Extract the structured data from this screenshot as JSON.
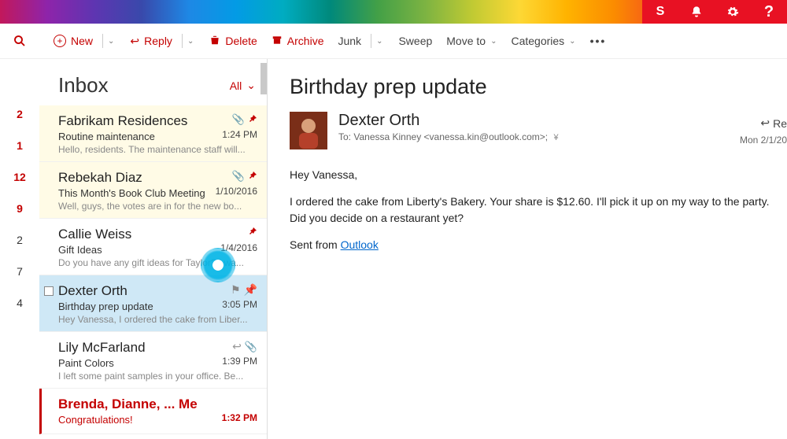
{
  "toolbar": {
    "new_label": "New",
    "reply_label": "Reply",
    "delete_label": "Delete",
    "archive_label": "Archive",
    "junk_label": "Junk",
    "sweep_label": "Sweep",
    "moveto_label": "Move to",
    "categories_label": "Categories"
  },
  "folder_counts": [
    "2",
    "1",
    "12",
    "9",
    "2",
    "7",
    "4"
  ],
  "list": {
    "title": "Inbox",
    "filter_label": "All"
  },
  "messages": [
    {
      "sender": "Fabrikam Residences",
      "subject": "Routine maintenance",
      "preview": "Hello, residents. The maintenance staff will...",
      "time": "1:24 PM",
      "pinned": true,
      "clip": true,
      "style": "yellow"
    },
    {
      "sender": "Rebekah Diaz",
      "subject": "This Month's Book Club Meeting",
      "preview": "Well, guys, the votes are in for the new bo...",
      "time": "1/10/2016",
      "pinned": true,
      "clip": true,
      "style": "yellow"
    },
    {
      "sender": "Callie Weiss",
      "subject": "Gift Ideas",
      "preview": "Do you have any gift ideas for Taylor? I wa...",
      "time": "1/4/2016",
      "pinned": true,
      "clip": false,
      "style": "plain"
    },
    {
      "sender": "Dexter Orth",
      "subject": "Birthday prep update",
      "preview": "Hey Vanessa, I ordered the cake from Liber...",
      "time": "3:05 PM",
      "pinned": false,
      "clip": false,
      "style": "selected"
    },
    {
      "sender": "Lily McFarland",
      "subject": "Paint Colors",
      "preview": "I left some paint samples in your office. Be...",
      "time": "1:39 PM",
      "pinned": false,
      "clip": true,
      "style": "plain_reply"
    },
    {
      "sender": "Brenda, Dianne, ... Me",
      "subject": "Congratulations!",
      "preview": "",
      "time": "1:32 PM",
      "pinned": false,
      "clip": false,
      "style": "red"
    }
  ],
  "reading": {
    "title": "Birthday prep update",
    "from_name": "Dexter Orth",
    "to_prefix": "To:",
    "to_value": "Vanessa Kinney <vanessa.kin@outlook.com>;",
    "reply_label": "Re",
    "date": "Mon 2/1/20",
    "body_greeting": "Hey Vanessa,",
    "body_p1": "I ordered the cake from Liberty's Bakery. Your share is $12.60. I'll pick it up on my way to the party. Did you decide on a restaurant yet?",
    "body_sig_prefix": "Sent from ",
    "body_sig_link": "Outlook"
  }
}
